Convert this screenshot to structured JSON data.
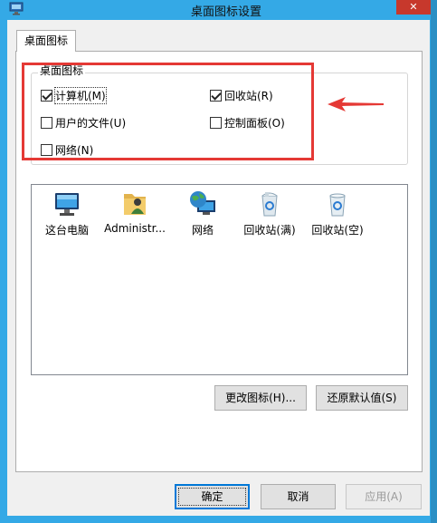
{
  "window": {
    "title": "桌面图标设置",
    "close_glyph": "✕",
    "app_icon": "desktop-settings-icon"
  },
  "tabs": [
    {
      "label": "桌面图标",
      "active": true
    }
  ],
  "group": {
    "label": "桌面图标",
    "checkboxes": [
      {
        "label": "计算机(M)",
        "checked": true,
        "focused": true
      },
      {
        "label": "回收站(R)",
        "checked": true,
        "focused": false
      },
      {
        "label": "用户的文件(U)",
        "checked": false,
        "focused": false
      },
      {
        "label": "控制面板(O)",
        "checked": false,
        "focused": false
      },
      {
        "label": "网络(N)",
        "checked": false,
        "focused": false
      }
    ]
  },
  "icons": [
    {
      "label": "这台电脑",
      "icon": "computer-icon"
    },
    {
      "label": "Administr...",
      "icon": "user-folder-icon"
    },
    {
      "label": "网络",
      "icon": "network-globe-icon"
    },
    {
      "label": "回收站(满)",
      "icon": "recycle-bin-full-icon"
    },
    {
      "label": "回收站(空)",
      "icon": "recycle-bin-empty-icon"
    }
  ],
  "panel_buttons": {
    "change_icon": "更改图标(H)...",
    "restore_default": "还原默认值(S)"
  },
  "dialog_buttons": {
    "ok": "确定",
    "cancel": "取消",
    "apply": "应用(A)"
  },
  "annotations": {
    "highlight_color": "#e53935"
  },
  "colors": {
    "titlebar": "#34a9e6",
    "close_button": "#c7382c",
    "default_button_border": "#0078d7"
  }
}
